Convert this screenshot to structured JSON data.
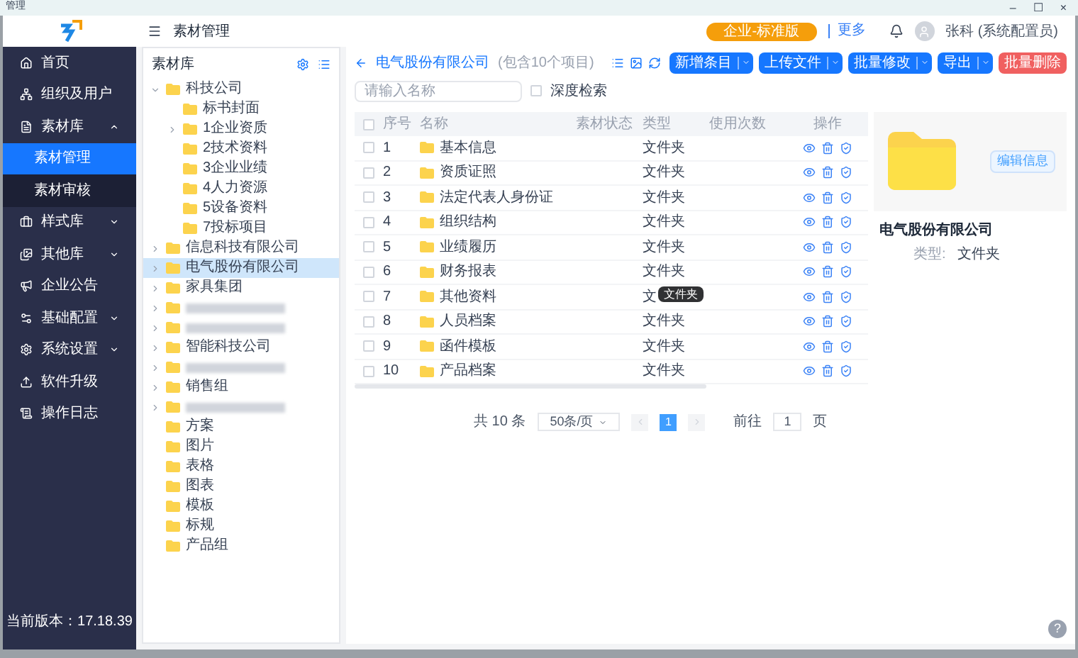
{
  "window": {
    "title": "管理",
    "controls": [
      "–",
      "☐",
      "×"
    ]
  },
  "header": {
    "title": "素材管理",
    "edition": "企业-标准版",
    "more": "更多",
    "user": "张科 (系统配置员)"
  },
  "sidebar": {
    "items": [
      {
        "label": "首页"
      },
      {
        "label": "组织及用户"
      },
      {
        "label": "素材库",
        "expanded": true,
        "children": [
          {
            "label": "素材管理",
            "selected": true
          },
          {
            "label": "素材审核",
            "selected": false
          }
        ]
      },
      {
        "label": "样式库",
        "expanded": false
      },
      {
        "label": "其他库",
        "expanded": false
      },
      {
        "label": "企业公告"
      },
      {
        "label": "基础配置",
        "expanded": false
      },
      {
        "label": "系统设置",
        "expanded": false
      },
      {
        "label": "软件升级"
      },
      {
        "label": "操作日志"
      }
    ],
    "version": "当前版本：17.18.39"
  },
  "tree": {
    "title": "素材库",
    "items": [
      {
        "kind": "folder",
        "label": "科技公司",
        "expanded": true,
        "selected": false,
        "children": [
          {
            "kind": "folder",
            "label": "标书封面",
            "selected": false
          },
          {
            "kind": "folder",
            "label": "1企业资质",
            "expanded": false,
            "selected": false
          },
          {
            "kind": "folder",
            "label": "2技术资料",
            "selected": false
          },
          {
            "kind": "folder",
            "label": "3企业业绩",
            "selected": false
          },
          {
            "kind": "folder",
            "label": "4人力资源",
            "selected": false
          },
          {
            "kind": "folder",
            "label": "5设备资料",
            "selected": false
          },
          {
            "kind": "folder",
            "label": "7投标项目",
            "selected": false
          }
        ]
      },
      {
        "kind": "folder",
        "label": "信息科技有限公司",
        "expanded": false,
        "selected": false
      },
      {
        "kind": "folder",
        "label": "电气股份有限公司",
        "expanded": false,
        "selected": true
      },
      {
        "kind": "folder",
        "label": "家具集团",
        "expanded": false,
        "selected": false
      },
      {
        "kind": "blurred",
        "expanded": false,
        "selected": false
      },
      {
        "kind": "blurred",
        "expanded": false,
        "selected": false
      },
      {
        "kind": "folder",
        "label": "智能科技公司",
        "expanded": false,
        "selected": false
      },
      {
        "kind": "blurred",
        "expanded": false,
        "selected": false
      },
      {
        "kind": "folder",
        "label": "销售组",
        "expanded": false,
        "selected": false
      },
      {
        "kind": "blurred",
        "expanded": false,
        "selected": false
      },
      {
        "kind": "folder",
        "label": "方案",
        "selected": false
      },
      {
        "kind": "folder",
        "label": "图片",
        "selected": false
      },
      {
        "kind": "folder",
        "label": "表格",
        "selected": false
      },
      {
        "kind": "folder",
        "label": "图表",
        "selected": false
      },
      {
        "kind": "folder",
        "label": "模板",
        "selected": false
      },
      {
        "kind": "folder",
        "label": "标规",
        "selected": false
      },
      {
        "kind": "folder",
        "label": "产品组",
        "selected": false
      }
    ]
  },
  "content": {
    "title": "电气股份有限公司",
    "count": "(包含10个项目)",
    "search": {
      "placeholder": "请输入名称"
    },
    "deep_search": {
      "label": "深度检索",
      "checked": false
    },
    "buttons": [
      {
        "label": "新增条目",
        "kind": "split"
      },
      {
        "label": "上传文件",
        "kind": "split"
      },
      {
        "label": "批量修改",
        "kind": "split"
      },
      {
        "label": "导出",
        "kind": "split"
      },
      {
        "label": "批量删除",
        "kind": "danger"
      }
    ],
    "table": {
      "all_checked": false,
      "columns": [
        "序号",
        "名称",
        "素材状态",
        "类型",
        "使用次数",
        "操作"
      ],
      "rows": [
        {
          "index": "1",
          "name": "基本信息",
          "type": "文件夹",
          "checked": false
        },
        {
          "index": "2",
          "name": "资质证照",
          "type": "文件夹",
          "checked": false
        },
        {
          "index": "3",
          "name": "法定代表人身份证",
          "type": "文件夹",
          "checked": false
        },
        {
          "index": "4",
          "name": "组织结构",
          "type": "文件夹",
          "checked": false
        },
        {
          "index": "5",
          "name": "业绩履历",
          "type": "文件夹",
          "checked": false
        },
        {
          "index": "6",
          "name": "财务报表",
          "type": "文件夹",
          "checked": false
        },
        {
          "index": "7",
          "name": "其他资料",
          "type": "文",
          "checked": false
        },
        {
          "index": "8",
          "name": "人员档案",
          "type": "文件夹",
          "checked": false
        },
        {
          "index": "9",
          "name": "函件模板",
          "type": "文件夹",
          "checked": false
        },
        {
          "index": "10",
          "name": "产品档案",
          "type": "文件夹",
          "checked": false
        }
      ]
    },
    "tooltip": "文件夹",
    "pagination": {
      "total": "共 10 条",
      "page_size": "50条/页",
      "pages": [
        {
          "label": "1",
          "selected": true
        }
      ],
      "goto": "前往",
      "goto_value": "1",
      "page_unit": "页"
    }
  },
  "detail": {
    "edit": "编辑信息",
    "name": "电气股份有限公司",
    "type_label": "类型:",
    "type_value": "文件夹"
  },
  "help": "?"
}
